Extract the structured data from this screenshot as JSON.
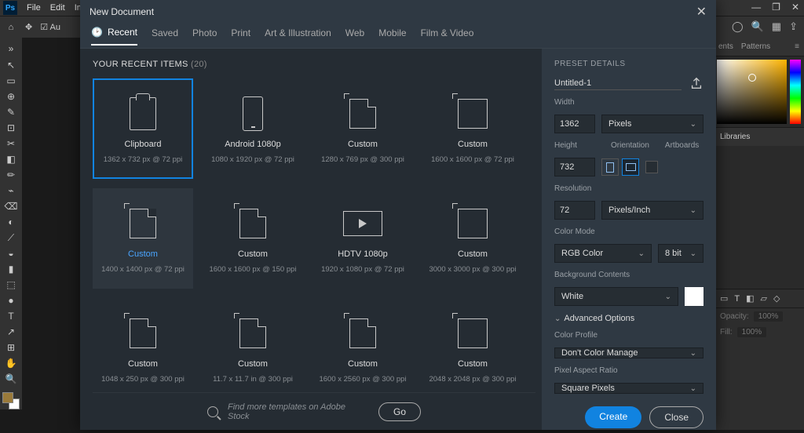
{
  "menubar": {
    "items": [
      "File",
      "Edit",
      "Image"
    ]
  },
  "toolbar": {
    "auto_label": "Au"
  },
  "window_controls": {
    "min": "—",
    "max": "❐",
    "close": "✕"
  },
  "header_icons": [
    "user-icon",
    "search-icon",
    "grid-icon",
    "share-icon"
  ],
  "dialog": {
    "title": "New Document",
    "tabs": [
      "Recent",
      "Saved",
      "Photo",
      "Print",
      "Art & Illustration",
      "Web",
      "Mobile",
      "Film & Video"
    ],
    "active_tab": 0,
    "recent": {
      "heading": "YOUR RECENT ITEMS",
      "count": "(20)",
      "items": [
        {
          "name": "Clipboard",
          "meta": "1362 x 732 px @ 72 ppi",
          "icon": "clip",
          "selected": true
        },
        {
          "name": "Android 1080p",
          "meta": "1080 x 1920 px @ 72 ppi",
          "icon": "phone"
        },
        {
          "name": "Custom",
          "meta": "1280 x 769 px @ 300 ppi",
          "icon": "page"
        },
        {
          "name": "Custom",
          "meta": "1600 x 1600 px @ 72 ppi",
          "icon": "square"
        },
        {
          "name": "Custom",
          "meta": "1400 x 1400 px @ 72 ppi",
          "icon": "page",
          "hover": true,
          "blue": true
        },
        {
          "name": "Custom",
          "meta": "1600 x 1600 px @ 150 ppi",
          "icon": "page"
        },
        {
          "name": "HDTV 1080p",
          "meta": "1920 x 1080 px @ 72 ppi",
          "icon": "video"
        },
        {
          "name": "Custom",
          "meta": "3000 x 3000 px @ 300 ppi",
          "icon": "square"
        },
        {
          "name": "Custom",
          "meta": "1048 x 250 px @ 300 ppi",
          "icon": "page"
        },
        {
          "name": "Custom",
          "meta": "11.7 x 11.7 in @ 300 ppi",
          "icon": "page"
        },
        {
          "name": "Custom",
          "meta": "1600 x 2560 px @ 300 ppi",
          "icon": "page"
        },
        {
          "name": "Custom",
          "meta": "2048 x 2048 px @ 300 ppi",
          "icon": "square"
        }
      ]
    },
    "search": {
      "placeholder": "Find more templates on Adobe Stock",
      "go": "Go"
    },
    "details": {
      "title": "PRESET DETAILS",
      "name": "Untitled-1",
      "width_label": "Width",
      "width": "1362",
      "width_unit": "Pixels",
      "height_label": "Height",
      "height": "732",
      "orientation_label": "Orientation",
      "artboards_label": "Artboards",
      "resolution_label": "Resolution",
      "resolution": "72",
      "resolution_unit": "Pixels/Inch",
      "colormode_label": "Color Mode",
      "colormode": "RGB Color",
      "bit": "8 bit",
      "bg_label": "Background Contents",
      "bg": "White",
      "advanced": "Advanced Options",
      "profile_label": "Color Profile",
      "profile": "Don't Color Manage",
      "par_label": "Pixel Aspect Ratio",
      "par": "Square Pixels",
      "create": "Create",
      "close": "Close"
    }
  },
  "right": {
    "tabs_top": [
      "ents",
      "Patterns"
    ],
    "libraries": "Libraries",
    "opacity_label": "Opacity:",
    "opacity_val": "100%",
    "fill_label": "Fill:",
    "fill_val": "100%"
  },
  "tools": [
    "↖",
    "▭",
    "⊕",
    "✎",
    "⊡",
    "✂",
    "◧",
    "✏",
    "⌁",
    "⌫",
    "◐",
    "⟋",
    "◒",
    "▮",
    "⬚",
    "●",
    "T",
    "↗",
    "⊞",
    "✋",
    "🔍"
  ]
}
